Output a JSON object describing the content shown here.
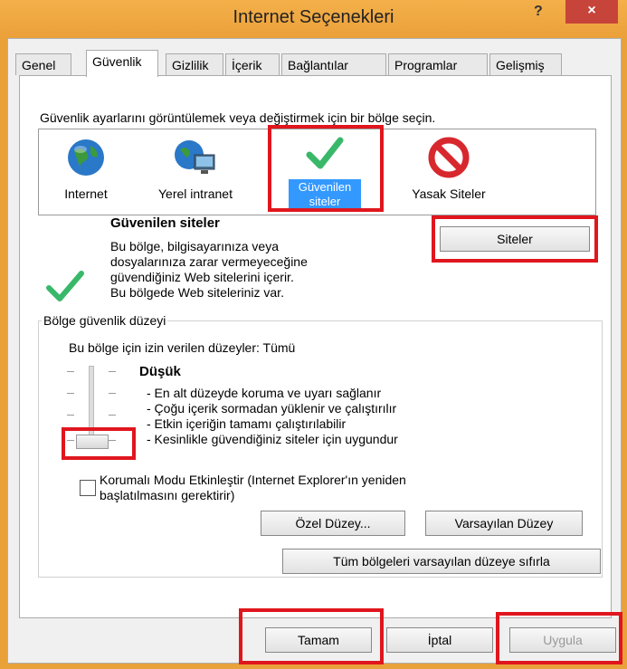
{
  "window": {
    "title": "Internet Seçenekleri",
    "help_glyph": "?",
    "close_glyph": "×"
  },
  "tabs": [
    {
      "label": "Genel"
    },
    {
      "label": "Güvenlik"
    },
    {
      "label": "Gizlilik"
    },
    {
      "label": "İçerik"
    },
    {
      "label": "Bağlantılar"
    },
    {
      "label": "Programlar"
    },
    {
      "label": "Gelişmiş"
    }
  ],
  "security": {
    "instruction": "Güvenlik ayarlarını görüntülemek veya değiştirmek için bir bölge seçin.",
    "zones": [
      {
        "label": "Internet",
        "icon": "globe-icon"
      },
      {
        "label": "Yerel intranet",
        "icon": "intranet-icon"
      },
      {
        "label_line1": "Güvenilen",
        "label_line2": "siteler",
        "icon": "checkmark-icon"
      },
      {
        "label": "Yasak Siteler",
        "icon": "blocked-icon"
      }
    ],
    "zone_title": "Güvenilen siteler",
    "zone_desc_1": "Bu bölge, bilgisayarınıza veya",
    "zone_desc_2": "dosyalarınıza zarar vermeyeceğine",
    "zone_desc_3": "güvendiğiniz Web sitelerini içerir.",
    "zone_desc_4": "Bu bölgede Web siteleriniz var.",
    "sites_button": "Siteler"
  },
  "level_group": {
    "title": "Bölge güvenlik düzeyi",
    "allowed": "Bu bölge için izin verilen düzeyler: Tümü",
    "level_name": "Düşük",
    "bullets": [
      "- En alt düzeyde koruma ve uyarı sağlanır",
      "- Çoğu içerik sormadan yüklenir ve çalıştırılır",
      "- Etkin içeriğin tamamı çalıştırılabilir",
      "- Kesinlikle güvendiğiniz siteler için uygundur"
    ],
    "protected_mode_1": "Korumalı Modu Etkinleştir (Internet Explorer'ın yeniden",
    "protected_mode_2": "başlatılmasını gerektirir)",
    "protected_mode_checked": false,
    "custom_button": "Özel Düzey...",
    "default_button": "Varsayılan Düzey"
  },
  "reset_all": "Tüm bölgeleri varsayılan düzeye sıfırla",
  "footer": {
    "ok": "Tamam",
    "cancel": "İptal",
    "apply": "Uygula"
  },
  "colors": {
    "accent": "#3399ff",
    "highlight": "#e0161e"
  }
}
